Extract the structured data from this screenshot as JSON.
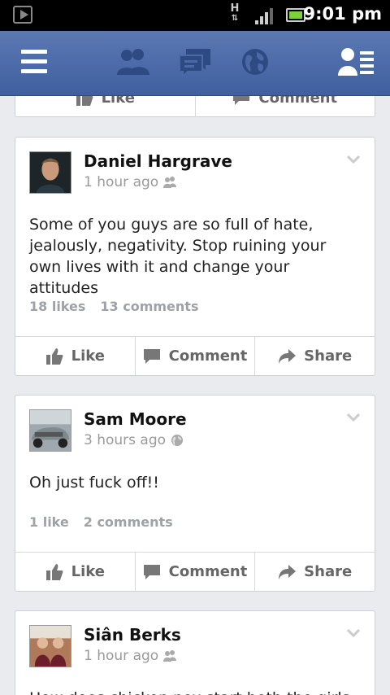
{
  "status_bar": {
    "time": "9:01 pm",
    "network_letter": "H"
  },
  "nav": {
    "icons": [
      "menu-icon",
      "friends-icon",
      "messages-icon",
      "globe-icon",
      "profile-menu-icon"
    ],
    "color": "#3f5f9f"
  },
  "partial_card": {
    "like_label": "Like",
    "comment_label": "Comment"
  },
  "posts": [
    {
      "author": "Daniel Hargrave",
      "time": "1 hour ago",
      "audience_icon": "friends-icon",
      "text": "Some of you guys are so full of hate, jealously, negativity. Stop ruining your own lives with it and change your attitudes",
      "likes": "18 likes",
      "comments": "13 comments",
      "like_label": "Like",
      "comment_label": "Comment",
      "share_label": "Share"
    },
    {
      "author": "Sam Moore",
      "time": "3 hours ago",
      "audience_icon": "public-globe-icon",
      "text": "Oh just fuck off!!",
      "likes": "1 like",
      "comments": "2 comments",
      "like_label": "Like",
      "comment_label": "Comment",
      "share_label": "Share"
    },
    {
      "author": "Siân Berks",
      "time": "1 hour ago",
      "audience_icon": "friends-icon",
      "text": "How does chicken pox start both the girls"
    }
  ]
}
